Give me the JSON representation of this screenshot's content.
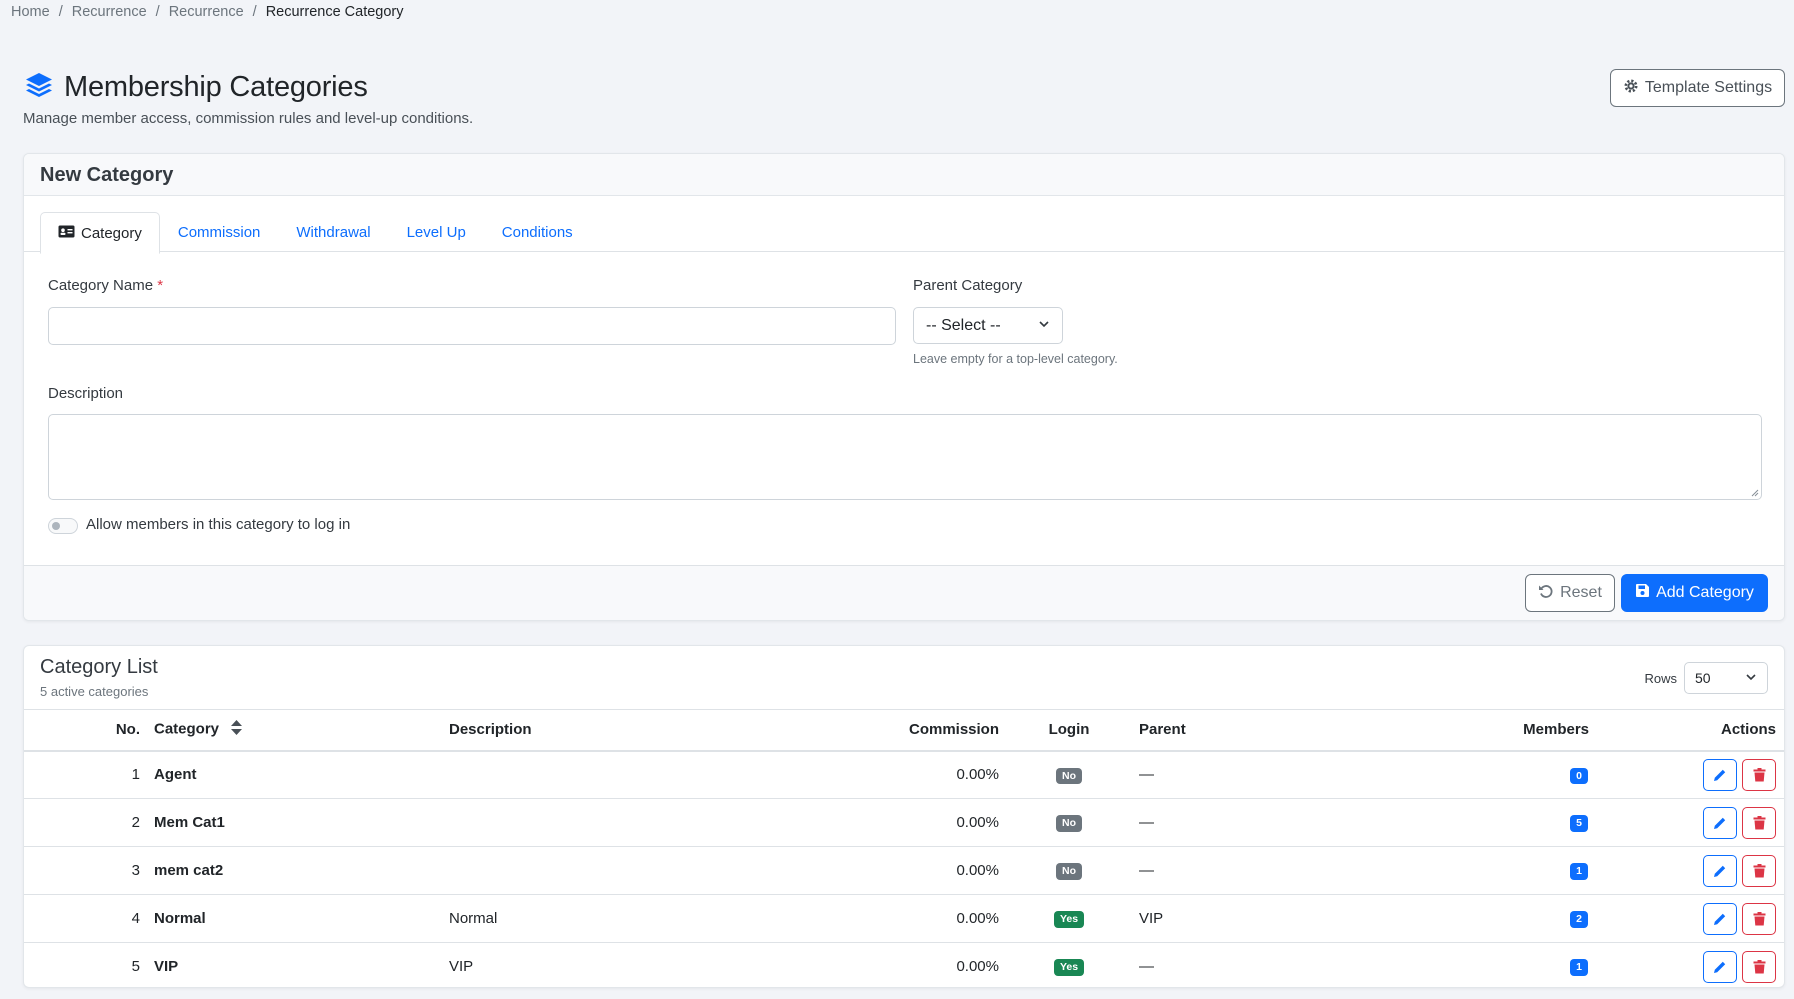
{
  "breadcrumb": [
    "Home",
    "Recurrence",
    "Recurrence",
    "Recurrence Category"
  ],
  "header": {
    "title": "Membership Categories",
    "subtitle": "Manage member access, commission rules and level-up conditions.",
    "template_settings": "Template Settings"
  },
  "form": {
    "card_title": "New Category",
    "tabs": [
      "Category",
      "Commission",
      "Withdrawal",
      "Level Up",
      "Conditions"
    ],
    "category_name_label": "Category Name",
    "required_mark": "*",
    "category_name_value": "",
    "parent_label": "Parent Category",
    "parent_selected": "-- Select --",
    "parent_hint": "Leave empty for a top-level category.",
    "description_label": "Description",
    "description_value": "",
    "login_switch_label": "Allow members in this category to log in",
    "reset_label": "Reset",
    "add_label": "Add Category"
  },
  "list": {
    "title": "Category List",
    "subtitle": "5 active categories",
    "rows_label": "Rows",
    "rows_value": "50",
    "columns": [
      "No.",
      "Category",
      "Description",
      "Commission",
      "Login",
      "Parent",
      "Members",
      "Actions"
    ],
    "rows": [
      {
        "no": "1",
        "category": "Agent",
        "description": "",
        "commission": "0.00%",
        "login": "No",
        "parent": "—",
        "members": "0"
      },
      {
        "no": "2",
        "category": "Mem Cat1",
        "description": "",
        "commission": "0.00%",
        "login": "No",
        "parent": "—",
        "members": "5"
      },
      {
        "no": "3",
        "category": "mem cat2",
        "description": "",
        "commission": "0.00%",
        "login": "No",
        "parent": "—",
        "members": "1"
      },
      {
        "no": "4",
        "category": "Normal",
        "description": "Normal",
        "commission": "0.00%",
        "login": "Yes",
        "parent": "VIP",
        "members": "2"
      },
      {
        "no": "5",
        "category": "VIP",
        "description": "VIP",
        "commission": "0.00%",
        "login": "Yes",
        "parent": "—",
        "members": "1"
      }
    ]
  },
  "colors": {
    "primary": "#0d6efd",
    "danger": "#dc3545",
    "success": "#198754",
    "secondary": "#6c757d"
  }
}
